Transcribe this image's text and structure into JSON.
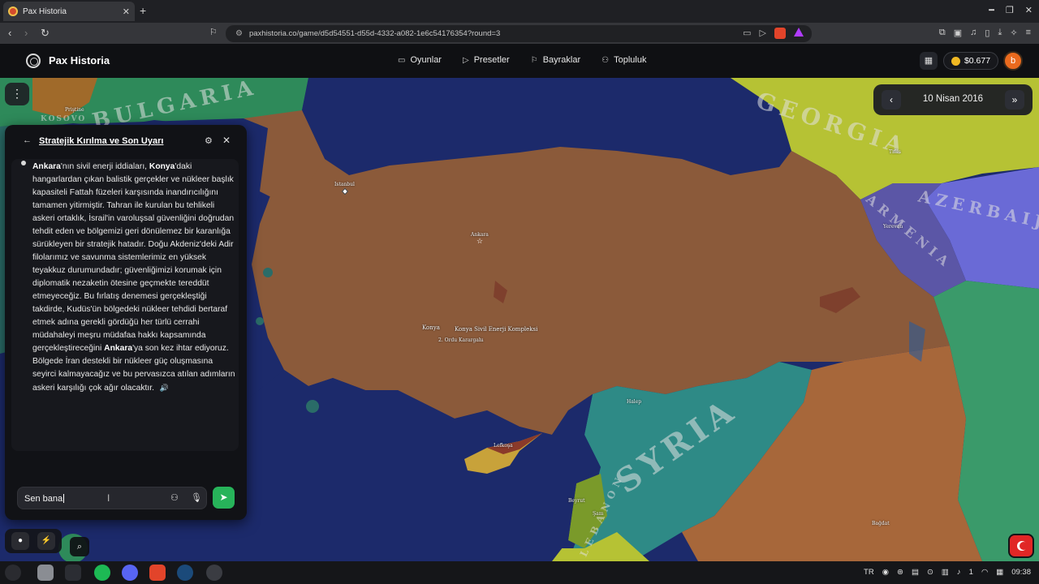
{
  "browser": {
    "tab_title": "Pax Historia",
    "url": "paxhistoria.co/game/d5d54551-d55d-4332-a082-1e6c54176354?round=3"
  },
  "app": {
    "brand": "Pax Historia",
    "nav": [
      {
        "label": "Oyunlar",
        "icon": "gamepad-icon"
      },
      {
        "label": "Presetler",
        "icon": "play-icon"
      },
      {
        "label": "Bayraklar",
        "icon": "flag-icon"
      },
      {
        "label": "Topluluk",
        "icon": "users-icon"
      }
    ],
    "balance": "$0.677",
    "avatar_letter": "b"
  },
  "map": {
    "date": "10 Nisan 2016",
    "region_labels": [
      "BULGARIA",
      "GEORGIA",
      "ARMENIA",
      "AZERBAIJ",
      "SYRIA",
      "LEBANON",
      "KOSOVO"
    ],
    "cities": [
      "Istanbul",
      "Ankara",
      "Konya",
      "Konya Sivil Enerji Kompleksi",
      "2. Ordu Karargahı",
      "Tiflis",
      "Yerevan",
      "Beyrut",
      "Şam",
      "Halep",
      "Lefkoşa",
      "Bağdat",
      "Priştine"
    ],
    "colors": {
      "sea": "#1c2a6b",
      "turkey": "#8b5a3a",
      "syria": "#2e8a86",
      "georgia": "#b6c234",
      "armenia": "#5b56a6",
      "azerbaijan": "#6a6ad6",
      "iraq": "#a7673a",
      "iran": "#3a9a6a",
      "bulgaria": "#2e8a5a",
      "cyprus": "#c8a23a",
      "lebanon": "#7a9a2a"
    }
  },
  "chat": {
    "title": "Stratejik Kırılma ve Son Uyarı",
    "message_html": "<b>Ankara</b>'nın sivil enerji iddiaları, <b>Konya</b>'daki hangarlardan çıkan balistik gerçekler ve nükleer başlık kapasiteli Fattah füzeleri karşısında inandırıcılığını tamamen yitirmiştir. Tahran ile kurulan bu tehlikeli askeri ortaklık, İsrail'in varoluşsal güvenliğini doğrudan tehdit eden ve bölgemizi geri dönülemez bir karanlığa sürükleyen bir stratejik hatadır. Doğu Akdeniz'deki Adir filolarımız ve savunma sistemlerimiz en yüksek teyakkuz durumundadır; güvenliğimizi korumak için diplomatik nezaketin ötesine geçmekte tereddüt etmeyeceğiz. Bu fırlatış denemesi gerçekleştiği takdirde, Kudüs'ün bölgedeki nükleer tehdidi bertaraf etmek adına gerekli gördüğü her türlü cerrahi müdahaleyi meşru müdafaa hakkı kapsamında gerçekleştireceğini <b>Ankara</b>'ya son kez ihtar ediyoruz. Bölgede İran destekli bir nükleer güç oluşmasına seyirci kalmayacağız ve bu pervasızca atılan adımların askeri karşılığı çok ağır olacaktır.",
    "input_value": "Sen bana"
  },
  "taskbar": {
    "lang": "TR",
    "time": "09:38",
    "count": "1"
  }
}
